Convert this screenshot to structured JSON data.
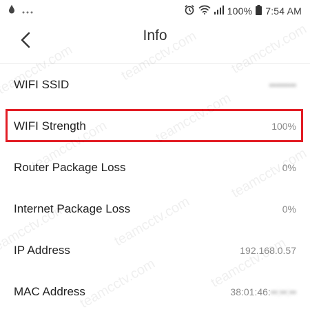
{
  "status_bar": {
    "battery": "100%",
    "time": "7:54 AM"
  },
  "header": {
    "title": "Info"
  },
  "rows": [
    {
      "label": "WIFI SSID",
      "value": "••••••••",
      "blurred": true
    },
    {
      "label": "WIFI Strength",
      "value": "100%"
    },
    {
      "label": "Router Package Loss",
      "value": "0%"
    },
    {
      "label": "Internet Package Loss",
      "value": "0%"
    },
    {
      "label": "IP Address",
      "value": "192.168.0.57"
    },
    {
      "label": "MAC Address",
      "value_prefix": "38:01:46:",
      "value_hidden": "••:••:••"
    }
  ],
  "watermark": "teamcctv.com",
  "colors": {
    "highlight": "#e21c24"
  }
}
